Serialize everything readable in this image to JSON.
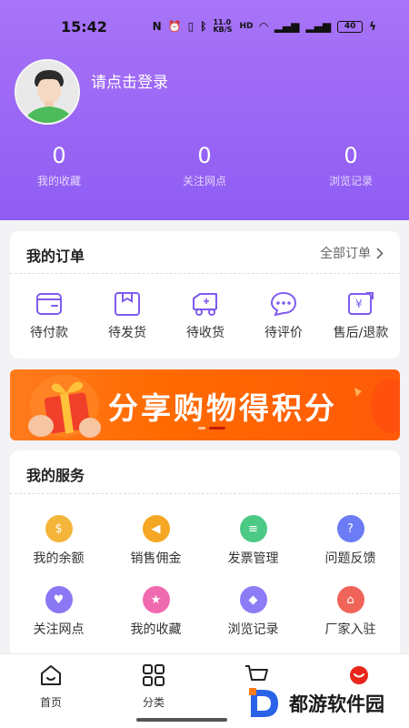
{
  "status_bar": {
    "time": "15:42",
    "network_speed": "11.0 KB/S",
    "battery": "40"
  },
  "profile": {
    "login_text": "请点击登录"
  },
  "stats": [
    {
      "value": "0",
      "label": "我的收藏"
    },
    {
      "value": "0",
      "label": "关注网点"
    },
    {
      "value": "0",
      "label": "浏览记录"
    }
  ],
  "orders": {
    "title": "我的订单",
    "all_label": "全部订单",
    "items": [
      {
        "label": "待付款",
        "icon": "wallet-icon"
      },
      {
        "label": "待发货",
        "icon": "box-icon"
      },
      {
        "label": "待收货",
        "icon": "truck-icon"
      },
      {
        "label": "待评价",
        "icon": "comment-icon"
      },
      {
        "label": "售后/退款",
        "icon": "refund-icon"
      }
    ]
  },
  "banner": {
    "text": "分享购物得积分"
  },
  "services": {
    "title": "我的服务",
    "items": [
      {
        "label": "我的余额",
        "icon": "money-bag-icon",
        "color": "#f4b53a"
      },
      {
        "label": "销售佣金",
        "icon": "megaphone-icon",
        "color": "#f5a623"
      },
      {
        "label": "发票管理",
        "icon": "invoice-icon",
        "color": "#4cc985"
      },
      {
        "label": "问题反馈",
        "icon": "question-icon",
        "color": "#6c7cf5"
      },
      {
        "label": "关注网点",
        "icon": "heart-icon",
        "color": "#8a78f4"
      },
      {
        "label": "我的收藏",
        "icon": "star-icon",
        "color": "#f06ab0"
      },
      {
        "label": "浏览记录",
        "icon": "footprint-icon",
        "color": "#8c7cf6"
      },
      {
        "label": "厂家入驻",
        "icon": "factory-icon",
        "color": "#f0645a"
      }
    ]
  },
  "tabbar": [
    {
      "label": "首页",
      "icon": "home-icon"
    },
    {
      "label": "分类",
      "icon": "grid-icon"
    },
    {
      "label": "",
      "icon": "cart-icon"
    },
    {
      "label": "",
      "icon": "profile-icon"
    }
  ],
  "watermark": {
    "text": "都游软件园"
  },
  "colors": {
    "brand_purple": "#9a66f5",
    "accent": "#7f5af0",
    "banner_orange": "#ff6a00"
  }
}
